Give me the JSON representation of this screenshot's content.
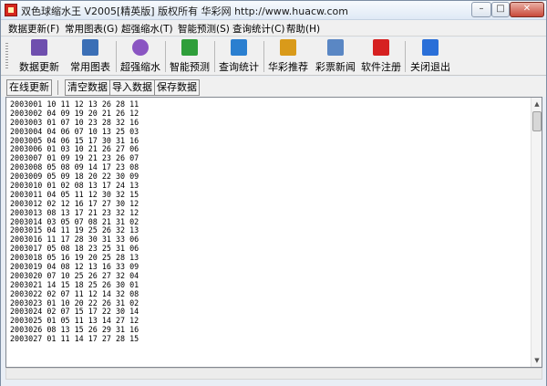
{
  "window": {
    "title": "双色球缩水王  V2005[精英版]  版权所有 华彩网 http://www.huacw.com",
    "minimize": "–",
    "maximize": "□",
    "close": "✕"
  },
  "menu": [
    {
      "label": "数据更新(F)"
    },
    {
      "label": "常用图表(G)"
    },
    {
      "label": "超强缩水(T)"
    },
    {
      "label": "智能预测(S)"
    },
    {
      "label": "查询统计(C)"
    },
    {
      "label": "帮助(H)"
    }
  ],
  "toolbar": [
    {
      "label": "数据更新",
      "icon": "books-icon",
      "color": "#6f4fae"
    },
    {
      "label": "常用图表",
      "icon": "chart-grid-icon",
      "color": "#3b6fb6"
    },
    {
      "label": "超强缩水",
      "icon": "cd-icon",
      "color": "#8a55c2"
    },
    {
      "label": "智能预测",
      "icon": "robot-icon",
      "color": "#2f9e3a"
    },
    {
      "label": "查询统计",
      "icon": "monitor-icon",
      "color": "#2a7fd0"
    },
    {
      "label": "华彩推荐",
      "icon": "coins-icon",
      "color": "#d99a1a"
    },
    {
      "label": "彩票新闻",
      "icon": "newspaper-icon",
      "color": "#5a87c4"
    },
    {
      "label": "软件注册",
      "icon": "fu-icon",
      "color": "#d62020"
    },
    {
      "label": "关闭退出",
      "icon": "exit-icon",
      "color": "#2a6fd8"
    }
  ],
  "actions": {
    "online_update": "在线更新",
    "clear": "清空数据",
    "import": "导入数据",
    "save": "保存数据"
  },
  "draws": [
    "2003001 10 11 12 13 26 28 11",
    "2003002 04 09 19 20 21 26 12",
    "2003003 01 07 10 23 28 32 16",
    "2003004 04 06 07 10 13 25 03",
    "2003005 04 06 15 17 30 31 16",
    "2003006 01 03 10 21 26 27 06",
    "2003007 01 09 19 21 23 26 07",
    "2003008 05 08 09 14 17 23 08",
    "2003009 05 09 18 20 22 30 09",
    "2003010 01 02 08 13 17 24 13",
    "2003011 04 05 11 12 30 32 15",
    "2003012 02 12 16 17 27 30 12",
    "2003013 08 13 17 21 23 32 12",
    "2003014 03 05 07 08 21 31 02",
    "2003015 04 11 19 25 26 32 13",
    "2003016 11 17 28 30 31 33 06",
    "2003017 05 08 18 23 25 31 06",
    "2003018 05 16 19 20 25 28 13",
    "2003019 04 08 12 13 16 33 09",
    "2003020 07 10 25 26 27 32 04",
    "2003021 14 15 18 25 26 30 01",
    "2003022 02 07 11 12 14 32 08",
    "2003023 01 10 20 22 26 31 02",
    "2003024 02 07 15 17 22 30 14",
    "2003025 01 05 11 13 14 27 12",
    "2003026 08 13 15 26 29 31 16",
    "2003027 01 11 14 17 27 28 15"
  ]
}
